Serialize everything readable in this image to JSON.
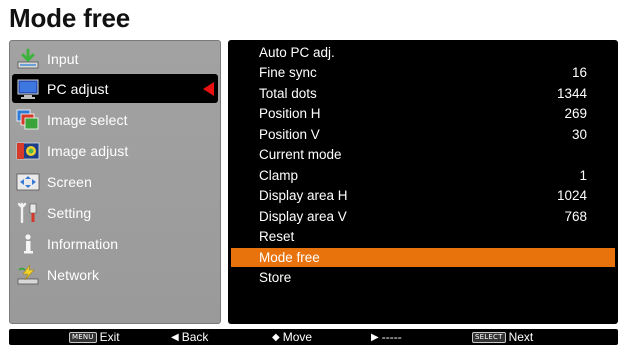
{
  "title": "Mode free",
  "menu": [
    {
      "label": "Input",
      "icon": "input-icon"
    },
    {
      "label": "PC adjust",
      "icon": "pc-adjust-icon",
      "selected": true
    },
    {
      "label": "Image select",
      "icon": "image-select-icon"
    },
    {
      "label": "Image adjust",
      "icon": "image-adjust-icon"
    },
    {
      "label": "Screen",
      "icon": "screen-icon"
    },
    {
      "label": "Setting",
      "icon": "setting-icon"
    },
    {
      "label": "Information",
      "icon": "information-icon"
    },
    {
      "label": "Network",
      "icon": "network-icon"
    }
  ],
  "submenu": [
    {
      "label": "Auto PC adj.",
      "value": ""
    },
    {
      "label": "Fine sync",
      "value": "16"
    },
    {
      "label": "Total dots",
      "value": "1344"
    },
    {
      "label": "Position H",
      "value": "269"
    },
    {
      "label": "Position V",
      "value": "30"
    },
    {
      "label": "Current mode",
      "value": ""
    },
    {
      "label": "Clamp",
      "value": "1"
    },
    {
      "label": "Display area H",
      "value": "1024"
    },
    {
      "label": "Display area V",
      "value": "768"
    },
    {
      "label": "Reset",
      "value": ""
    },
    {
      "label": "Mode free",
      "value": "",
      "highlighted": true
    },
    {
      "label": "Store",
      "value": ""
    }
  ],
  "status": {
    "exit_key": "MENU",
    "exit": "Exit",
    "back_glyph": "◀",
    "back": "Back",
    "move_glyph": "◆",
    "move": "Move",
    "right_glyph": "▶",
    "right": "-----",
    "next_key": "SELECT",
    "next": "Next"
  },
  "colors": {
    "highlight": "#e8720c",
    "pointer": "#e81010",
    "panel": "#9e9e9e"
  }
}
